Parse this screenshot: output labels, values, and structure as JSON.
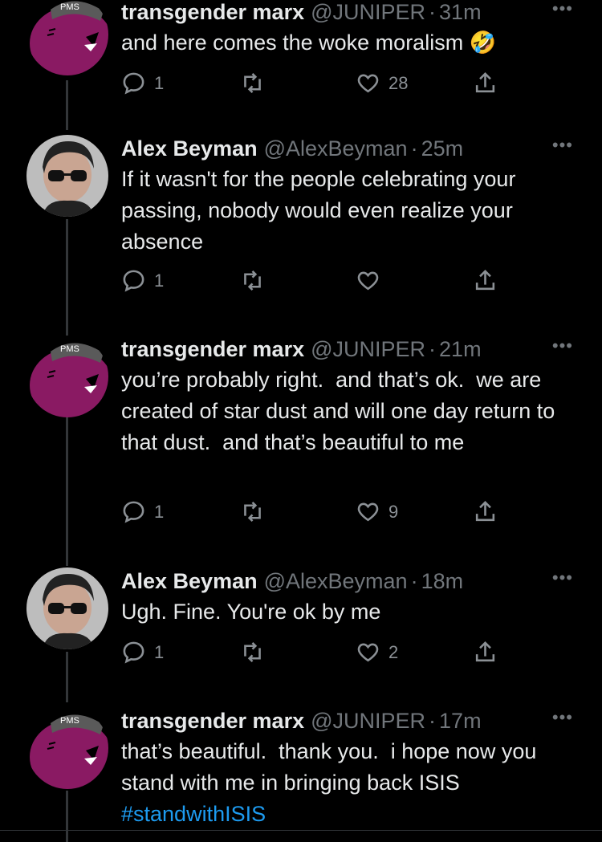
{
  "tweets": [
    {
      "author": "transgender marx",
      "handle": "@JUNIPER",
      "separator": "·",
      "time": "31m",
      "text": "and here comes the woke moralism",
      "emoji": "🤣",
      "replies": "1",
      "retweets": "",
      "likes": "28"
    },
    {
      "author": "Alex Beyman",
      "handle": "@AlexBeyman",
      "separator": "·",
      "time": "25m",
      "text": "If it wasn't for the people celebrating your passing, nobody would even realize your absence",
      "replies": "1",
      "retweets": "",
      "likes": ""
    },
    {
      "author": "transgender marx",
      "handle": "@JUNIPER",
      "separator": "·",
      "time": "21m",
      "text": "you’re probably right.  and that’s ok.  we are created of star dust and will one day return to that dust.  and that’s beautiful to me",
      "replies": "1",
      "retweets": "",
      "likes": "9"
    },
    {
      "author": "Alex Beyman",
      "handle": "@AlexBeyman",
      "separator": "·",
      "time": "18m",
      "text": "Ugh. Fine. You're ok by me",
      "replies": "1",
      "retweets": "",
      "likes": "2"
    },
    {
      "author": "transgender marx",
      "handle": "@JUNIPER",
      "separator": "·",
      "time": "17m",
      "text": "that’s beautiful.  thank you.  i hope now you stand with me in bringing back ISIS",
      "hashtag": "#standwithISIS",
      "replies": "",
      "retweets": "",
      "likes": ""
    }
  ],
  "more_label": "•••",
  "avatar_text": "PMS",
  "colors": {
    "background": "#000000",
    "text": "#e7e9ea",
    "muted": "#71767b",
    "link": "#1d9bf0",
    "avatar_purple": "#8a1a63"
  }
}
